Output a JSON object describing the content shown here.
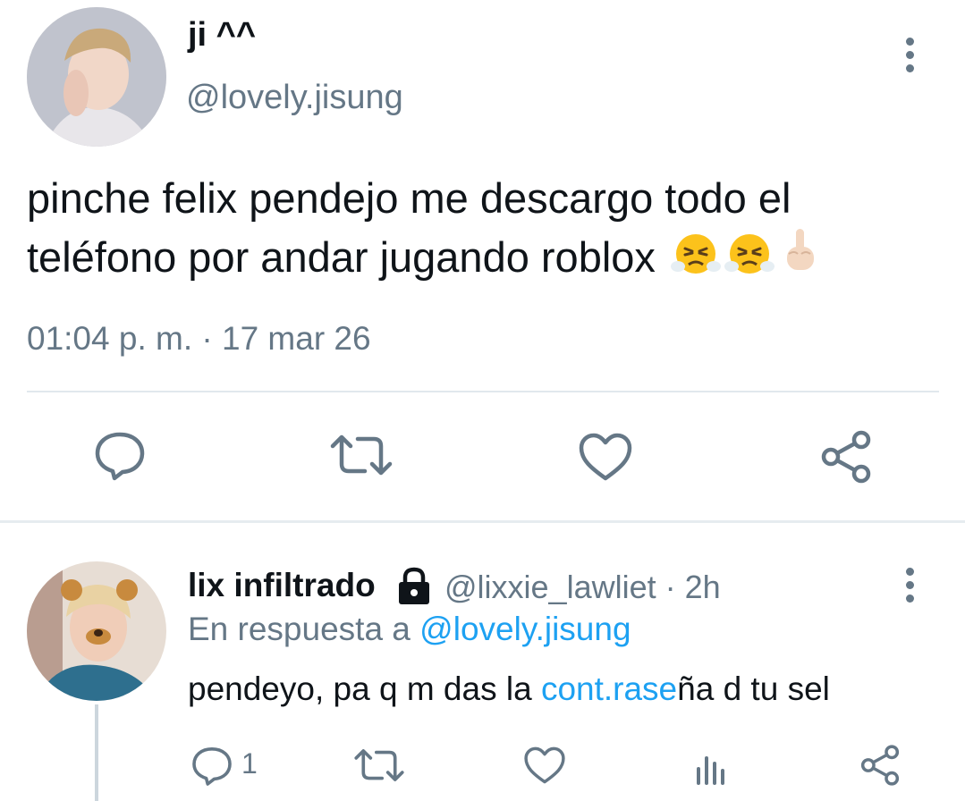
{
  "tweet": {
    "display_name": "ji ^^",
    "handle": "@lovely.jisung",
    "text_line1": "pinche felix pendejo me descargo todo el",
    "text_line2": "teléfono por andar jugando roblox",
    "emojis": [
      "face-with-steam-from-nose",
      "face-with-steam-from-nose",
      "middle-finger-light-skin"
    ],
    "timestamp": "01:04 p. m. · 17 mar 26",
    "actions": [
      "reply-icon",
      "retweet-icon",
      "like-icon",
      "share-icon"
    ]
  },
  "reply": {
    "display_name": "lix infiltrado",
    "protected": true,
    "handle_time": "@lixxie_lawliet · 2h",
    "in_reply_prefix": "En respuesta a ",
    "in_reply_handle": "@lovely.jisung",
    "text_before": "pendeyo, pa q m das la ",
    "text_link": "cont.rase",
    "text_after": "ña d tu sel",
    "reply_count": "1",
    "actions": [
      "reply-icon",
      "retweet-icon",
      "like-icon",
      "stats-icon",
      "share-icon"
    ]
  },
  "colors": {
    "text": "#0f1419",
    "secondary": "#657786",
    "link": "#1da1f2",
    "divider": "#e1e8ed"
  }
}
